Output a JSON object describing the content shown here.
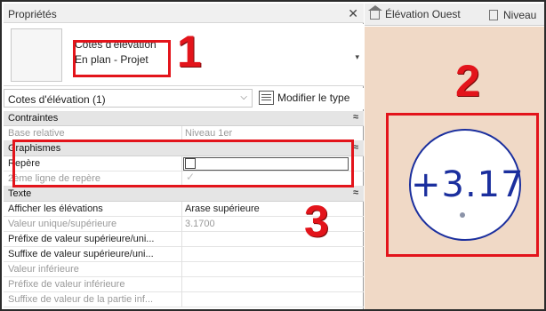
{
  "panel": {
    "title": "Propriétés",
    "close_glyph": "✕"
  },
  "type_selector": {
    "type_line1": "Cotes d'élévation",
    "type_line2": "En plan - Projet",
    "dropdown_glyph": "▾"
  },
  "instance_selector": {
    "label": "Cotes d'élévation (1)",
    "arrow_glyph": "⌵",
    "edit_type_label": "Modifier le type"
  },
  "groups": {
    "contraintes": {
      "title": "Contraintes",
      "rows": [
        {
          "key": "Base relative",
          "value": "Niveau 1er"
        }
      ]
    },
    "graphismes": {
      "title": "Graphismes",
      "rows": [
        {
          "key": "Repère",
          "checked": false
        },
        {
          "key": "2ème ligne de repère",
          "checked": true,
          "disabled": true
        }
      ]
    },
    "texte": {
      "title": "Texte",
      "rows": [
        {
          "key": "Afficher les élévations",
          "value": "Arase supérieure"
        },
        {
          "key": "Valeur unique/supérieure",
          "value": "3.1700"
        },
        {
          "key": "Préfixe de valeur supérieure/uni...",
          "value": ""
        },
        {
          "key": "Suffixe de valeur supérieure/uni...",
          "value": ""
        },
        {
          "key": "Valeur inférieure",
          "value": ""
        },
        {
          "key": "Préfixe de valeur inférieure",
          "value": ""
        },
        {
          "key": "Suffixe de valeur de la partie inf...",
          "value": ""
        }
      ]
    }
  },
  "collapse_glyph": "≈",
  "annotations": {
    "n1": "1",
    "n2": "2",
    "n3": "3"
  },
  "view": {
    "tab_active": "Élévation Ouest",
    "tab_next": "Niveau",
    "tag_value": "+3.17"
  },
  "colors": {
    "annotation_red": "#e3141b",
    "tag_blue": "#1b2f9e",
    "view_background": "#f0d9c6"
  }
}
